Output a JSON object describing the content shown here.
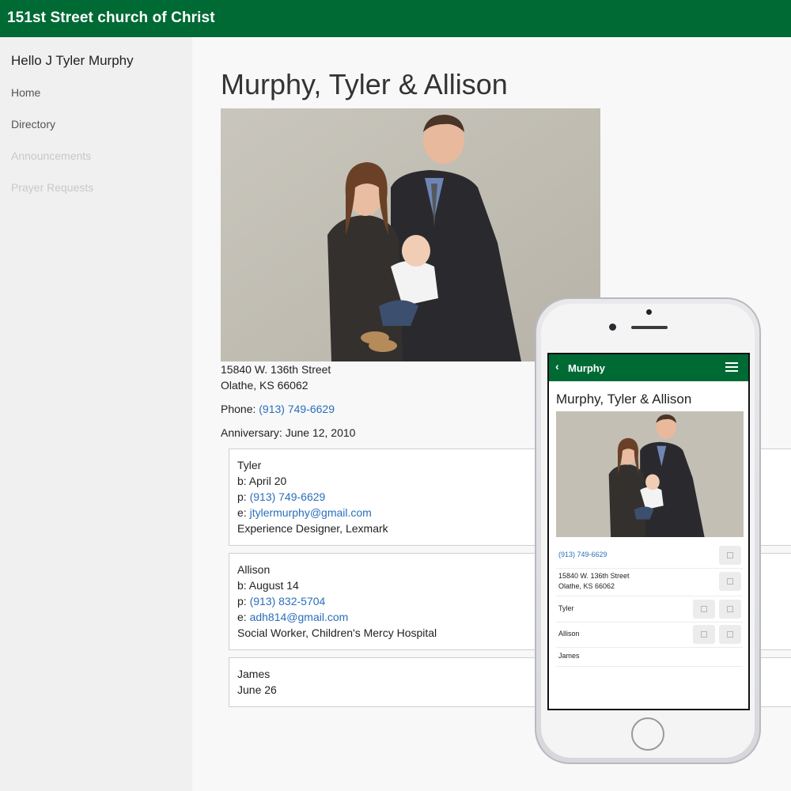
{
  "app": {
    "title": "151st Street church of Christ"
  },
  "sidebar": {
    "greeting": "Hello J Tyler Murphy",
    "items": [
      {
        "label": "Home"
      },
      {
        "label": "Directory"
      },
      {
        "label": "Announcements"
      },
      {
        "label": "Prayer Requests"
      }
    ]
  },
  "family": {
    "name": "Murphy, Tyler & Allison",
    "address_line1": "15840 W. 136th Street",
    "address_line2": "Olathe, KS 66062",
    "phone_label": "Phone:",
    "phone": "(913) 749-6629",
    "anniversary": "Anniversary: June 12, 2010"
  },
  "members": [
    {
      "name": "Tyler",
      "birthday": "b: April 20",
      "phone_prefix": "p:",
      "phone": "(913) 749-6629",
      "email_prefix": "e:",
      "email": "jtylermurphy@gmail.com",
      "occupation": "Experience Designer, Lexmark"
    },
    {
      "name": "Allison",
      "birthday": "b: August 14",
      "phone_prefix": "p:",
      "phone": "(913) 832-5704",
      "email_prefix": "e:",
      "email": "adh814@gmail.com",
      "occupation": "Social Worker, Children's Mercy Hospital"
    },
    {
      "name": "James",
      "birthday": "June 26"
    }
  ],
  "mobile": {
    "back_icon": "chevron-left-icon",
    "bar_title": "Murphy",
    "menu_icon": "hamburger-icon",
    "title": "Murphy, Tyler & Allison",
    "phone": "(913) 749-6629",
    "address_line1": "15840 W. 136th Street",
    "address_line2": "Olathe, KS 66062",
    "members": [
      "Tyler",
      "Allison",
      "James"
    ]
  },
  "colors": {
    "brand": "#006a35",
    "link": "#2a6ebb",
    "disabled": "#c8c8c8"
  }
}
